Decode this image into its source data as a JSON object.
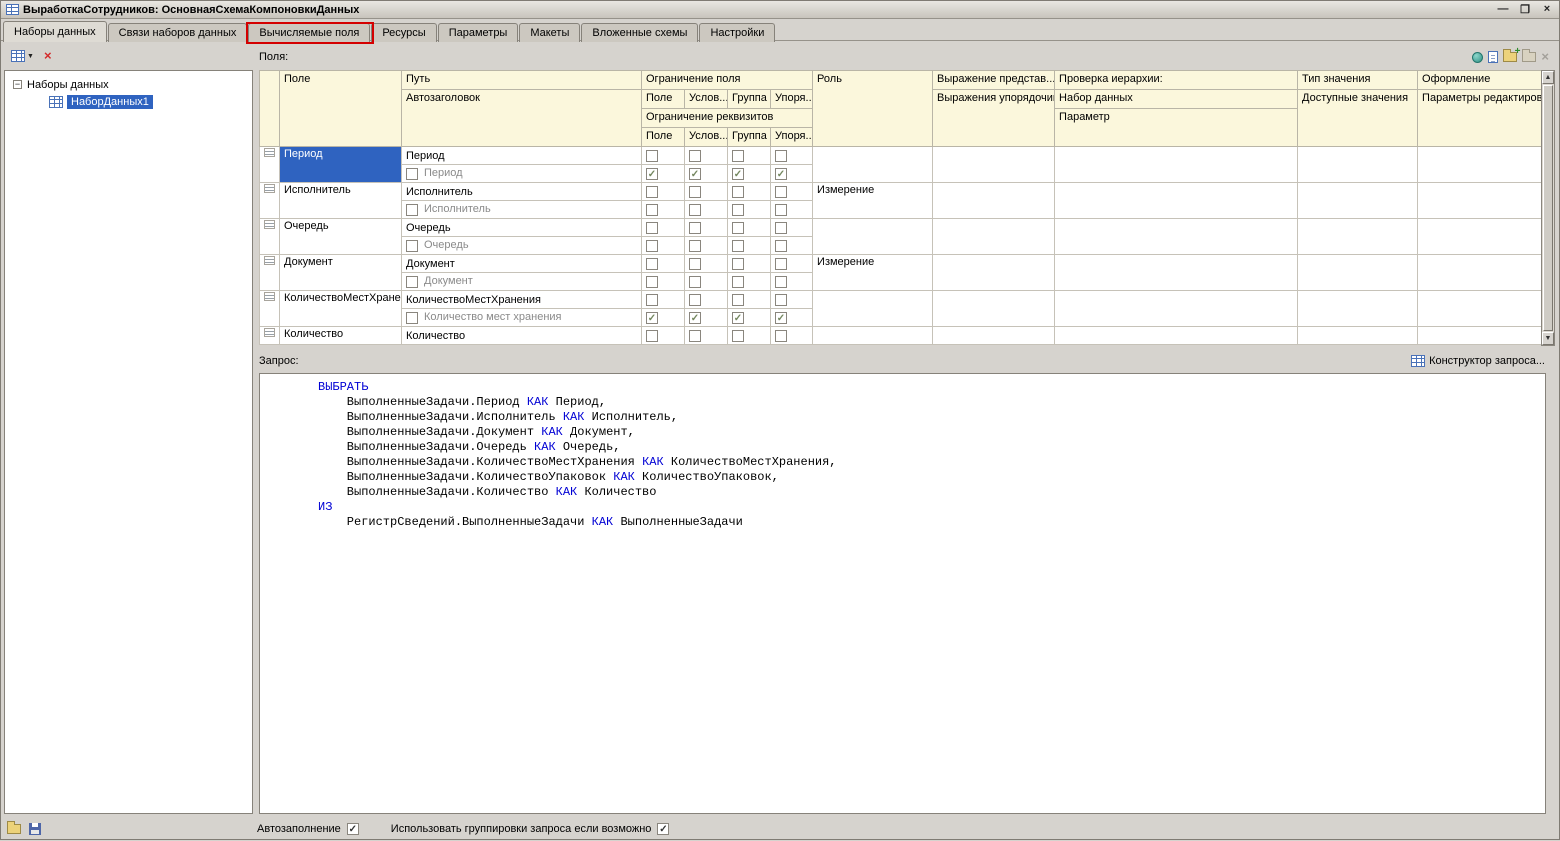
{
  "icons": {
    "check": "✓",
    "minimize": "—",
    "restore": "❐",
    "close": "×",
    "delete": "×",
    "dropdown": "▼",
    "expander_collapse": "−",
    "scroll_up": "▲",
    "scroll_down": "▼"
  },
  "window": {
    "title": "ВыработкаСотрудников: ОсновнаяСхемаКомпоновкиДанных"
  },
  "tabs": [
    {
      "label": "Наборы данных",
      "active": true,
      "highlighted": false
    },
    {
      "label": "Связи наборов данных",
      "active": false,
      "highlighted": false
    },
    {
      "label": "Вычисляемые поля",
      "active": false,
      "highlighted": true
    },
    {
      "label": "Ресурсы",
      "active": false,
      "highlighted": false
    },
    {
      "label": "Параметры",
      "active": false,
      "highlighted": false
    },
    {
      "label": "Макеты",
      "active": false,
      "highlighted": false
    },
    {
      "label": "Вложенные схемы",
      "active": false,
      "highlighted": false
    },
    {
      "label": "Настройки",
      "active": false,
      "highlighted": false
    }
  ],
  "left_panel": {
    "root_label": "Наборы данных",
    "items": [
      {
        "label": "НаборДанных1",
        "selected": true
      }
    ]
  },
  "fields": {
    "label": "Поля:",
    "header": {
      "field": "Поле",
      "path": "Путь",
      "auto_title": "Автозаголовок",
      "field_restriction_group": "Ограничение поля",
      "attr_restriction_group": "Ограничение реквизитов",
      "restriction_cols": [
        "Поле",
        "Услов...",
        "Группа",
        "Упоря..."
      ],
      "role": "Роль",
      "presentation_expr": "Выражение представ...",
      "ordering_expr": "Выражения упорядочивания",
      "hierarchy_check": "Проверка иерархии:",
      "data_set": "Набор данных",
      "parameter": "Параметр",
      "value_type": "Тип значения",
      "available_values": "Доступные значения",
      "appearance": "Оформление",
      "edit_parameters": "Параметры редактирования"
    },
    "rows": [
      {
        "field": "Период",
        "path": "Период",
        "auto_title": "Период",
        "role": "",
        "selected": true,
        "main_checks": [
          false,
          false,
          false,
          false
        ],
        "sub_checks": [
          true,
          true,
          true,
          true
        ]
      },
      {
        "field": "Исполнитель",
        "path": "Исполнитель",
        "auto_title": "Исполнитель",
        "role": "Измерение",
        "selected": false,
        "main_checks": [
          false,
          false,
          false,
          false
        ],
        "sub_checks": [
          false,
          false,
          false,
          false
        ]
      },
      {
        "field": "Очередь",
        "path": "Очередь",
        "auto_title": "Очередь",
        "role": "",
        "selected": false,
        "main_checks": [
          false,
          false,
          false,
          false
        ],
        "sub_checks": [
          false,
          false,
          false,
          false
        ]
      },
      {
        "field": "Документ",
        "path": "Документ",
        "auto_title": "Документ",
        "role": "Измерение",
        "selected": false,
        "main_checks": [
          false,
          false,
          false,
          false
        ],
        "sub_checks": [
          false,
          false,
          false,
          false
        ]
      },
      {
        "field": "КоличествоМестХранения",
        "path": "КоличествоМестХранения",
        "auto_title": "Количество мест хранения",
        "role": "",
        "selected": false,
        "main_checks": [
          false,
          false,
          false,
          false
        ],
        "sub_checks": [
          true,
          true,
          true,
          true
        ]
      },
      {
        "field": "Количество",
        "path": "Количество",
        "auto_title": null,
        "role": "",
        "selected": false,
        "main_checks": [
          false,
          false,
          false,
          false
        ],
        "sub_checks": null
      }
    ]
  },
  "query": {
    "label": "Запрос:",
    "constructor_label": "Конструктор запроса...",
    "keywords": [
      "ВЫБРАТЬ",
      "КАК",
      "ИЗ"
    ],
    "lines": [
      "ВЫБРАТЬ",
      "    ВыполненныеЗадачи.Период КАК Период,",
      "    ВыполненныеЗадачи.Исполнитель КАК Исполнитель,",
      "    ВыполненныеЗадачи.Документ КАК Документ,",
      "    ВыполненныеЗадачи.Очередь КАК Очередь,",
      "    ВыполненныеЗадачи.КоличествоМестХранения КАК КоличествоМестХранения,",
      "    ВыполненныеЗадачи.КоличествоУпаковок КАК КоличествоУпаковок,",
      "    ВыполненныеЗадачи.Количество КАК Количество",
      "ИЗ",
      "    РегистрСведений.ВыполненныеЗадачи КАК ВыполненныеЗадачи"
    ]
  },
  "footer": {
    "autofill_label": "Автозаполнение",
    "autofill_checked": true,
    "grouping_label": "Использовать группировки запроса если возможно",
    "grouping_checked": true
  }
}
